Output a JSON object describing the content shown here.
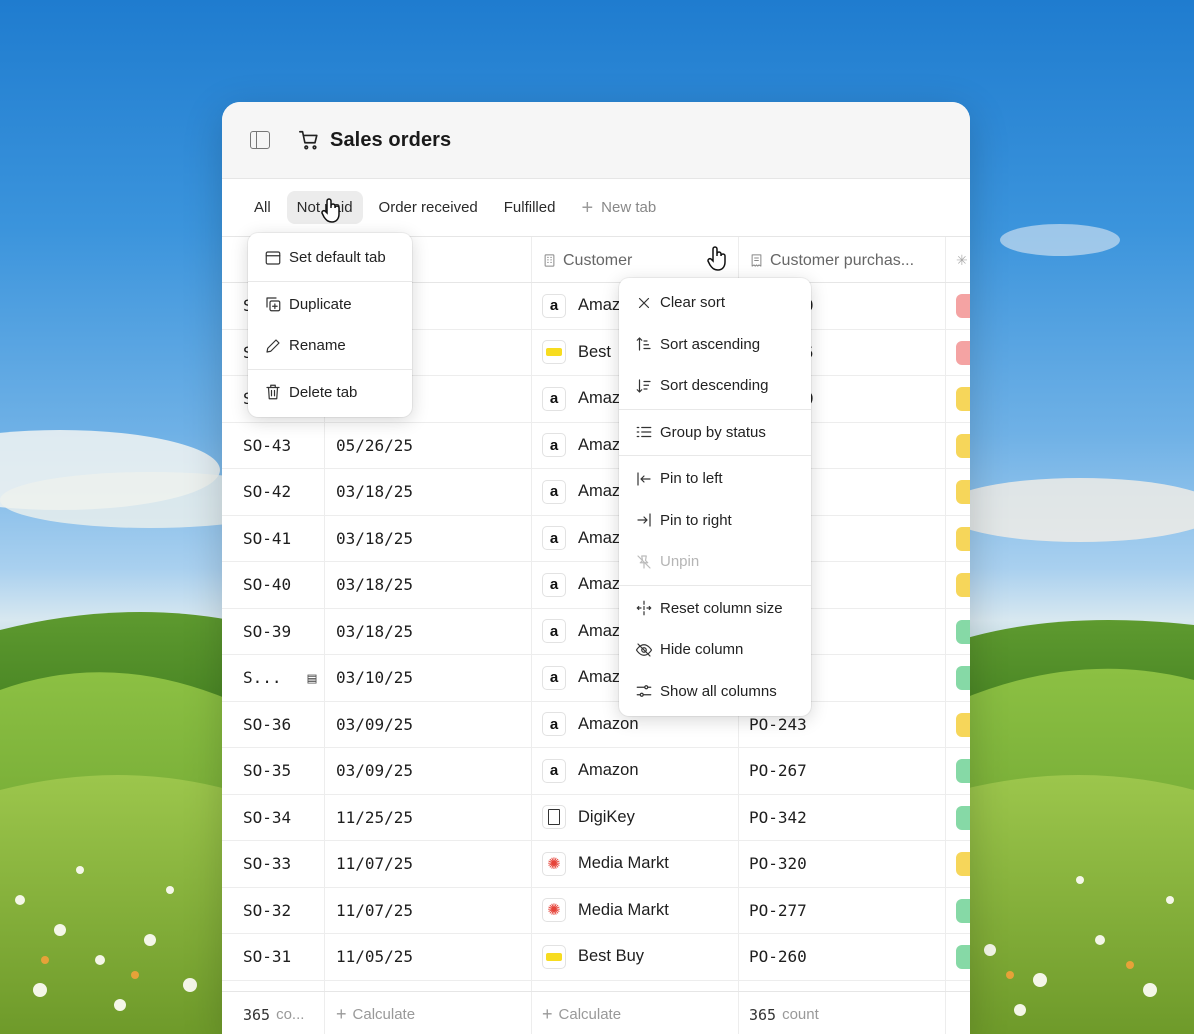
{
  "window": {
    "title": "Sales orders"
  },
  "tabs": [
    {
      "label": "All"
    },
    {
      "label": "Not paid"
    },
    {
      "label": "Order received"
    },
    {
      "label": "Fulfilled"
    }
  ],
  "new_tab_label": "New tab",
  "columns": {
    "customer": "Customer",
    "customer_po": "Customer purchas..."
  },
  "rows": [
    {
      "id": "SO-43",
      "date": "05/26/25",
      "customer": "Amazon",
      "logo": "amazon",
      "po": "PO-255",
      "status_color": "#f6d65a"
    },
    {
      "id": "SO-42",
      "date": "03/18/25",
      "customer": "Amazon",
      "logo": "amazon",
      "po": "PO-276",
      "status_color": "#f6d65a"
    },
    {
      "id": "SO-41",
      "date": "03/18/25",
      "customer": "Amazon",
      "logo": "amazon",
      "po": "PO-275",
      "status_color": "#f6d65a"
    },
    {
      "id": "SO-40",
      "date": "03/18/25",
      "customer": "Amazon",
      "logo": "amazon",
      "po": "PO-236",
      "status_color": "#f6d65a"
    },
    {
      "id": "SO-39",
      "date": "03/18/25",
      "customer": "Amazon",
      "logo": "amazon",
      "po": "PO-238",
      "status_color": "#86d9a6"
    },
    {
      "id": "S...",
      "date": "03/10/25",
      "customer": "Amazon",
      "logo": "amazon",
      "po": "PO-247",
      "status_color": "#86d9a6"
    },
    {
      "id": "SO-36",
      "date": "03/09/25",
      "customer": "Amazon",
      "logo": "amazon",
      "po": "PO-243",
      "status_color": "#f6d65a"
    },
    {
      "id": "SO-35",
      "date": "03/09/25",
      "customer": "Amazon",
      "logo": "amazon",
      "po": "PO-267",
      "status_color": "#86d9a6"
    },
    {
      "id": "SO-34",
      "date": "11/25/25",
      "customer": "DigiKey",
      "logo": "digikey",
      "po": "PO-342",
      "status_color": "#86d9a6"
    },
    {
      "id": "SO-33",
      "date": "11/07/25",
      "customer": "Media Markt",
      "logo": "media",
      "po": "PO-320",
      "status_color": "#f6d65a"
    },
    {
      "id": "SO-32",
      "date": "11/07/25",
      "customer": "Media Markt",
      "logo": "media",
      "po": "PO-277",
      "status_color": "#86d9a6"
    },
    {
      "id": "SO-31",
      "date": "11/05/25",
      "customer": "Best Buy",
      "logo": "bestbuy",
      "po": "PO-260",
      "status_color": "#86d9a6"
    }
  ],
  "top_rows": [
    {
      "customer": "Amaz",
      "logo": "amazon",
      "po_tail": "9",
      "status_color": "#f4a3a3"
    },
    {
      "customer": "Best",
      "logo": "bestbuy",
      "po_tail": "5",
      "status_color": "#f4a3a3"
    },
    {
      "customer": "Amaz",
      "logo": "amazon",
      "po_tail": "0",
      "status_color": "#f6d65a"
    }
  ],
  "footer": {
    "count_id": "365",
    "count_id_suffix": "co...",
    "calculate": "Calculate",
    "count_po": "365",
    "count_po_suffix": "count"
  },
  "tab_menu": {
    "items": [
      "Set default tab",
      "Duplicate",
      "Rename",
      "Delete tab"
    ]
  },
  "column_menu": {
    "items": [
      "Clear sort",
      "Sort ascending",
      "Sort descending",
      "Group by status",
      "Pin to left",
      "Pin to right",
      "Unpin",
      "Reset column size",
      "Hide column",
      "Show all columns"
    ]
  }
}
